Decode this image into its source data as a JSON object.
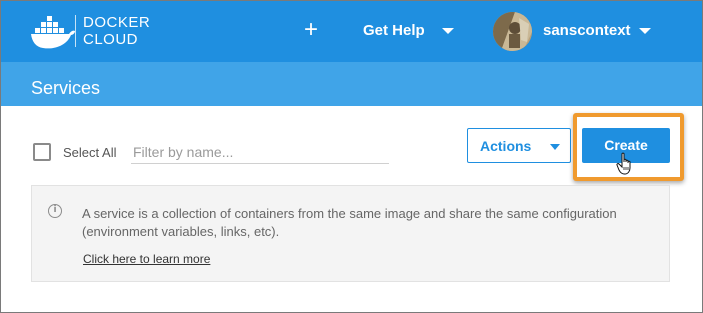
{
  "header": {
    "brand_line1": "DOCKER",
    "brand_line2": "CLOUD",
    "logo_icon": "docker-whale-icon",
    "plus_label": "+",
    "help_label": "Get Help",
    "username": "sanscontext",
    "accent_color": "#1f8fe0"
  },
  "servicebar": {
    "title": "Services",
    "color": "#40a4e8"
  },
  "toolbar": {
    "select_all_label": "Select All",
    "filter_placeholder": "Filter by name...",
    "actions_label": "Actions",
    "create_label": "Create",
    "highlight_color": "#f09a2e"
  },
  "info": {
    "icon": "info-icon",
    "text": "A service is a collection of containers from the same image and share the same configuration (environment variables, links, etc).",
    "link_label": "Click here to learn more"
  }
}
